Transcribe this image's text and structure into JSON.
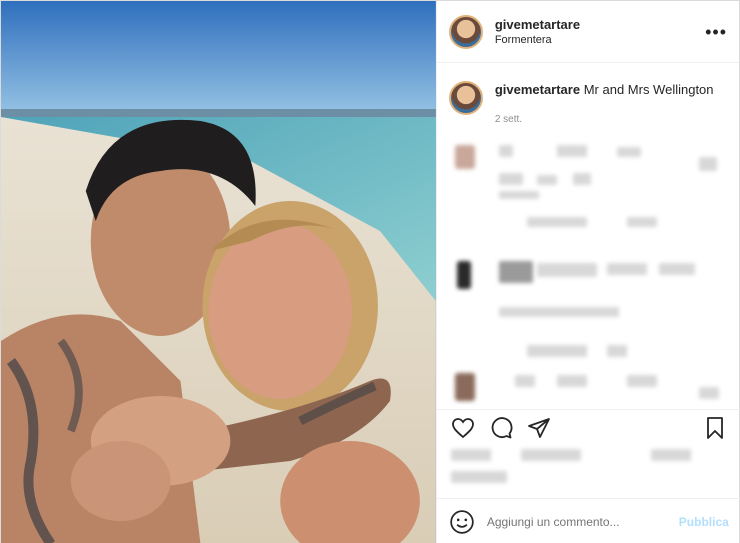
{
  "post": {
    "username": "givemetartare",
    "location": "Formentera",
    "more_icon": "more-horizontal-icon",
    "caption_text": "Mr and Mrs Wellington",
    "age": "2 sett."
  },
  "comment_box": {
    "placeholder": "Aggiungi un commento...",
    "publish_label": "Pubblica"
  },
  "icons": {
    "like": "heart-icon",
    "comment": "comment-bubble-icon",
    "share": "paper-plane-icon",
    "save": "bookmark-icon",
    "emoji": "smiley-icon"
  },
  "colors": {
    "text": "#262626",
    "secondary": "#8e8e8e",
    "publish_disabled": "#b2dffc",
    "divider": "#efefef"
  }
}
